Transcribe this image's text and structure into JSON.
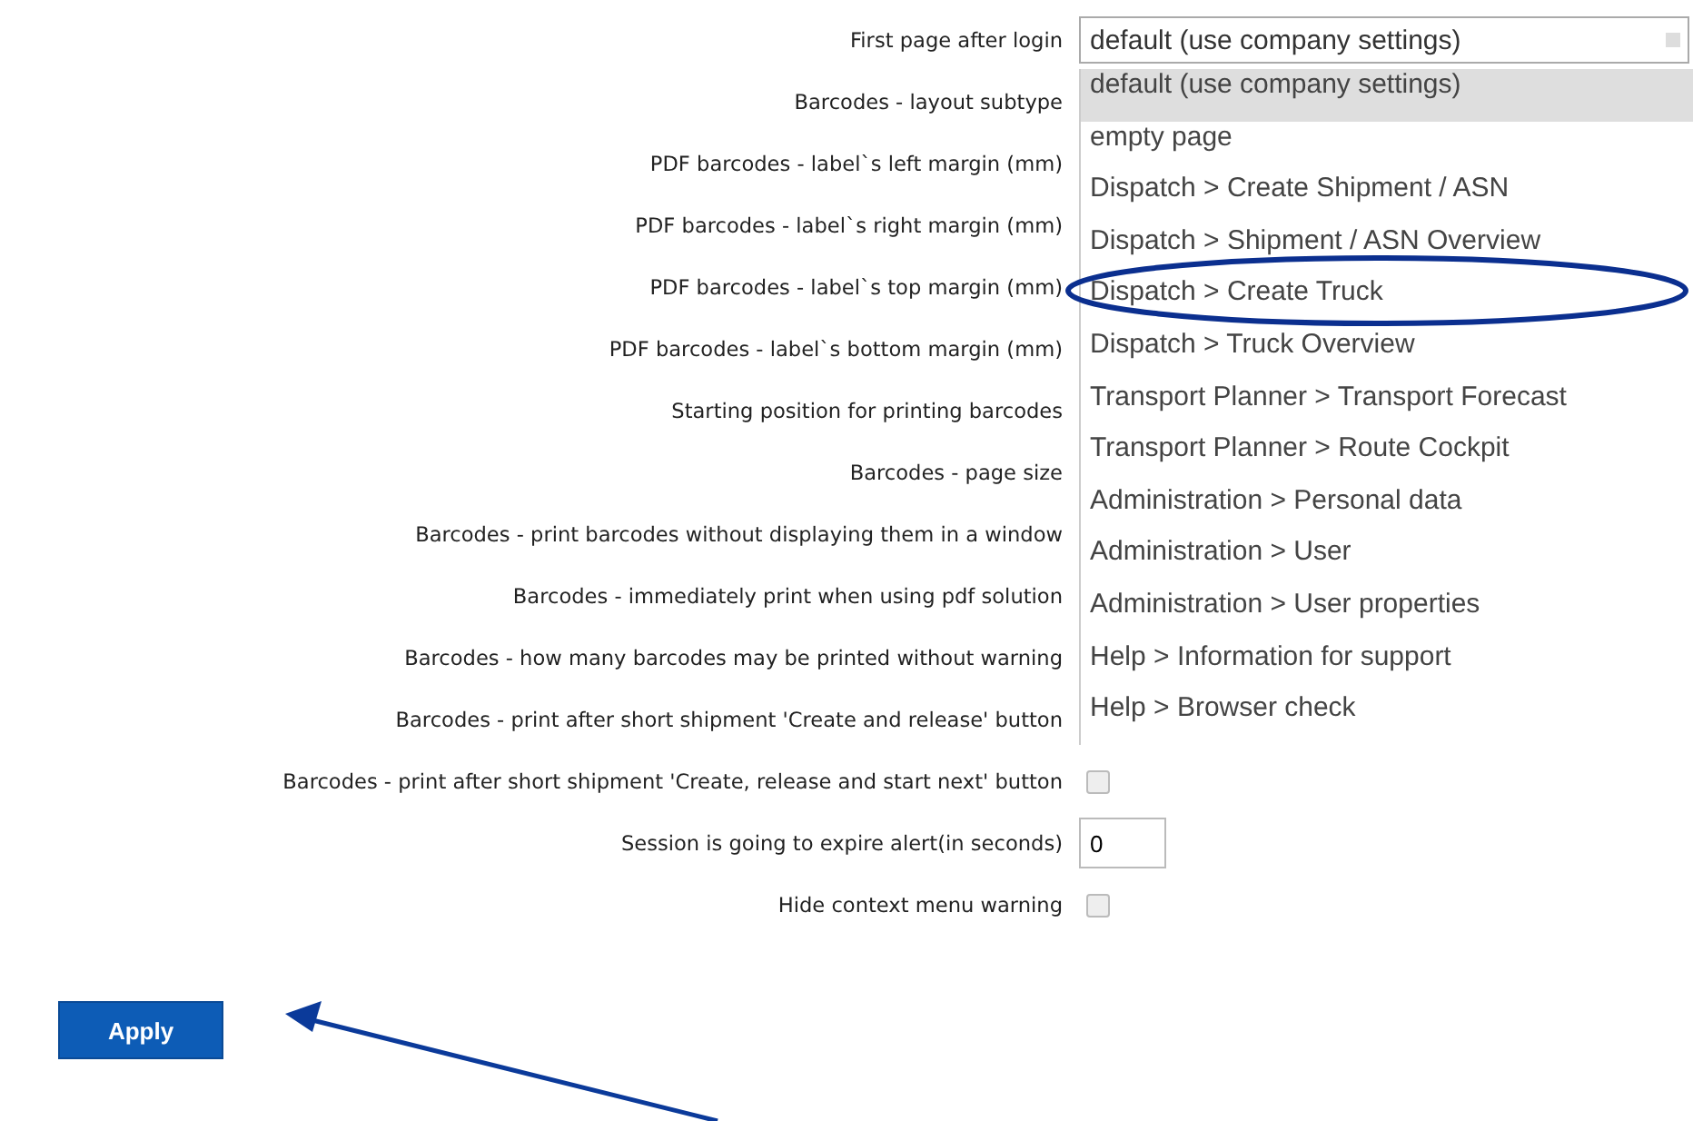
{
  "settings": [
    {
      "label": "First page after login",
      "control": {
        "kind": "select",
        "value": "default (use company settings)",
        "expanded": true,
        "options": [
          {
            "label": "default (use company settings)",
            "selected": true
          },
          {
            "label": "empty page",
            "selected": false
          },
          {
            "label": "Dispatch > Create Shipment / ASN",
            "selected": false
          },
          {
            "label": "Dispatch > Shipment / ASN Overview",
            "selected": false
          },
          {
            "label": "Dispatch > Create Truck",
            "selected": false
          },
          {
            "label": "Dispatch > Truck Overview",
            "selected": false
          },
          {
            "label": "Transport Planner > Transport Forecast",
            "selected": false
          },
          {
            "label": "Transport Planner > Route Cockpit",
            "selected": false
          },
          {
            "label": "Administration > Personal data",
            "selected": false
          },
          {
            "label": "Administration > User",
            "selected": false
          },
          {
            "label": "Administration > User properties",
            "selected": false
          },
          {
            "label": "Help > Information for support",
            "selected": false
          },
          {
            "label": "Help > Browser check",
            "selected": false
          }
        ]
      }
    },
    {
      "label": "Barcodes - layout subtype"
    },
    {
      "label": "PDF barcodes - label`s left margin (mm)"
    },
    {
      "label": "PDF barcodes - label`s right margin (mm)"
    },
    {
      "label": "PDF barcodes - label`s top margin (mm)"
    },
    {
      "label": "PDF barcodes - label`s bottom margin (mm)"
    },
    {
      "label": "Starting position for printing barcodes"
    },
    {
      "label": "Barcodes - page size"
    },
    {
      "label": "Barcodes - print barcodes without displaying them in a window"
    },
    {
      "label": "Barcodes - immediately print when using pdf solution"
    },
    {
      "label": "Barcodes - how many barcodes may be printed without warning"
    },
    {
      "label": "Barcodes - print after short shipment 'Create and release' button"
    },
    {
      "label": "Barcodes - print after short shipment 'Create, release and start next' button",
      "control": {
        "kind": "checkbox",
        "checked": false
      }
    },
    {
      "label": "Session is going to expire alert(in seconds)",
      "control": {
        "kind": "text",
        "value": "0"
      }
    },
    {
      "label": "Hide context menu warning",
      "control": {
        "kind": "checkbox",
        "checked": false
      }
    }
  ],
  "apply_button": "Apply"
}
